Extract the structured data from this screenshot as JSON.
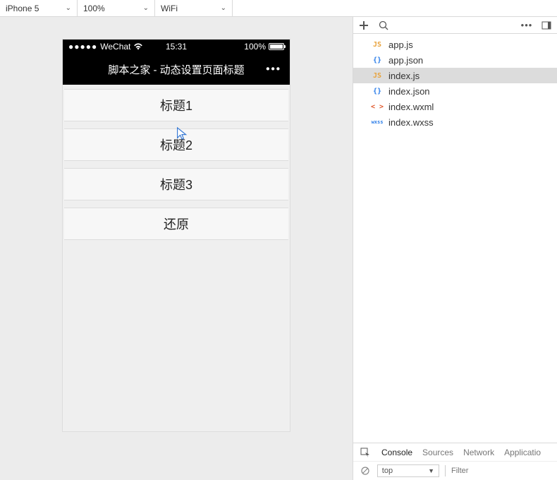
{
  "toolbar": {
    "device": "iPhone 5",
    "zoom": "100%",
    "network": "WiFi"
  },
  "statusbar": {
    "carrier": "WeChat",
    "time": "15:31",
    "battery_pct": "100%"
  },
  "navbar": {
    "title": "脚本之家 - 动态设置页面标题"
  },
  "buttons": [
    {
      "label": "标题1"
    },
    {
      "label": "标题2"
    },
    {
      "label": "标题3"
    },
    {
      "label": "还原"
    }
  ],
  "right_toolbar": {
    "add_icon": "plus-icon",
    "search_icon": "search-icon",
    "more_icon": "more-icon",
    "panel_icon": "panel-toggle-icon"
  },
  "files": [
    {
      "name": "app.js",
      "icon": "JS",
      "cls": "ic-js",
      "selected": false
    },
    {
      "name": "app.json",
      "icon": "{}",
      "cls": "ic-json",
      "selected": false
    },
    {
      "name": "index.js",
      "icon": "JS",
      "cls": "ic-js",
      "selected": true
    },
    {
      "name": "index.json",
      "icon": "{}",
      "cls": "ic-json",
      "selected": false
    },
    {
      "name": "index.wxml",
      "icon": "< >",
      "cls": "ic-wxml",
      "selected": false
    },
    {
      "name": "index.wxss",
      "icon": "wxss",
      "cls": "ic-wxss",
      "selected": false
    }
  ],
  "devtools": {
    "tabs": [
      "Console",
      "Sources",
      "Network",
      "Applicatio"
    ],
    "active_tab": "Console",
    "context": "top",
    "filter_placeholder": "Filter"
  }
}
